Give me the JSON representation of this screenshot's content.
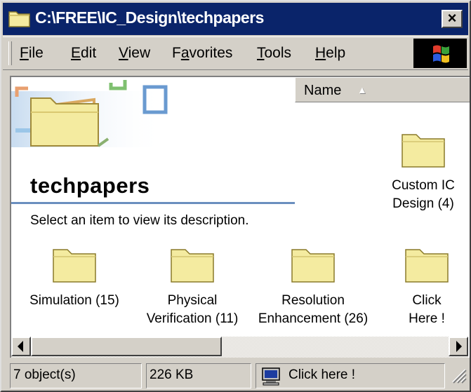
{
  "window": {
    "title": "C:\\FREE\\IC_Design\\techpapers",
    "close_label": "×"
  },
  "menu": [
    {
      "accel": "F",
      "rest": "ile"
    },
    {
      "accel": "E",
      "rest": "dit"
    },
    {
      "accel": "V",
      "rest": "iew"
    },
    {
      "pre": "F",
      "accel": "a",
      "rest": "vorites"
    },
    {
      "accel": "T",
      "rest": "ools"
    },
    {
      "accel": "H",
      "rest": "elp"
    }
  ],
  "webview": {
    "folder_name": "techpapers",
    "description": "Select an item to view its description."
  },
  "column_header": {
    "name": "Name",
    "sort": "▲"
  },
  "items": [
    {
      "label": "Custom IC\nDesign (4)",
      "icon": "folder-icon"
    },
    {
      "label": "Simulation (15)",
      "icon": "folder-icon"
    },
    {
      "label": "Physical\nVerification (11)",
      "icon": "folder-icon"
    },
    {
      "label": "Resolution\nEnhancement (26)",
      "icon": "folder-icon"
    },
    {
      "label": "Click\nHere !",
      "icon": "folder-icon"
    }
  ],
  "status": {
    "objects": "7 object(s)",
    "size": "226 KB",
    "zone": "Click here !"
  },
  "colors": {
    "titlebar": "#0a246a",
    "folder": "#f4eba0",
    "face": "#d4d0c8"
  }
}
